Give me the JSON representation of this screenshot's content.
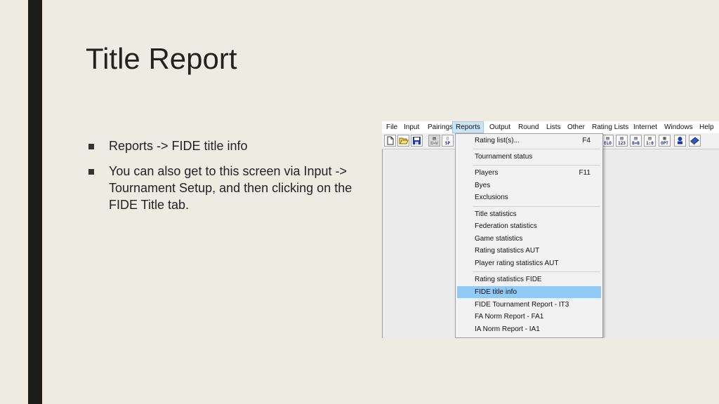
{
  "slide": {
    "title": "Title Report",
    "bullets": [
      "Reports -> FIDE title info",
      "You can also get to this screen via Input -> Tournament Setup, and then clicking on the FIDE Title tab."
    ]
  },
  "app": {
    "menubar": [
      "File",
      "Input",
      "Pairings",
      "Reports",
      "Output",
      "Round",
      "Lists",
      "Other",
      "Rating Lists",
      "Internet",
      "Windows",
      "Help"
    ],
    "active_menu": "Reports",
    "toolbar": {
      "disabled_label": "B=W",
      "sp_label": "SP",
      "elo_label": "ELO",
      "numbers_label": "123",
      "bw_label": "B=B",
      "score_label": "1:0",
      "opt_label": "OPT"
    },
    "reports_menu": {
      "items": [
        {
          "label": "Rating list(s)...",
          "shortcut": "F4"
        },
        {
          "label": "Tournament status",
          "shortcut": ""
        },
        {
          "label": "Players",
          "shortcut": "F11"
        },
        {
          "label": "Byes",
          "shortcut": ""
        },
        {
          "label": "Exclusions",
          "shortcut": ""
        },
        {
          "label": "Title statistics",
          "shortcut": ""
        },
        {
          "label": "Federation statistics",
          "shortcut": ""
        },
        {
          "label": "Game statistics",
          "shortcut": ""
        },
        {
          "label": "Rating statistics AUT",
          "shortcut": ""
        },
        {
          "label": "Player rating statistics AUT",
          "shortcut": ""
        },
        {
          "label": "Rating statistics FIDE",
          "shortcut": ""
        },
        {
          "label": "FIDE title info",
          "shortcut": ""
        },
        {
          "label": "FIDE Tournament Report - IT3",
          "shortcut": ""
        },
        {
          "label": "FA Norm Report - FA1",
          "shortcut": ""
        },
        {
          "label": "IA Norm Report - IA1",
          "shortcut": ""
        }
      ],
      "selected": "FIDE title info"
    }
  },
  "colors": {
    "slide_background": "#eeebe3",
    "left_bar": "#1c1c16",
    "menu_highlight": "#91c9f7"
  }
}
